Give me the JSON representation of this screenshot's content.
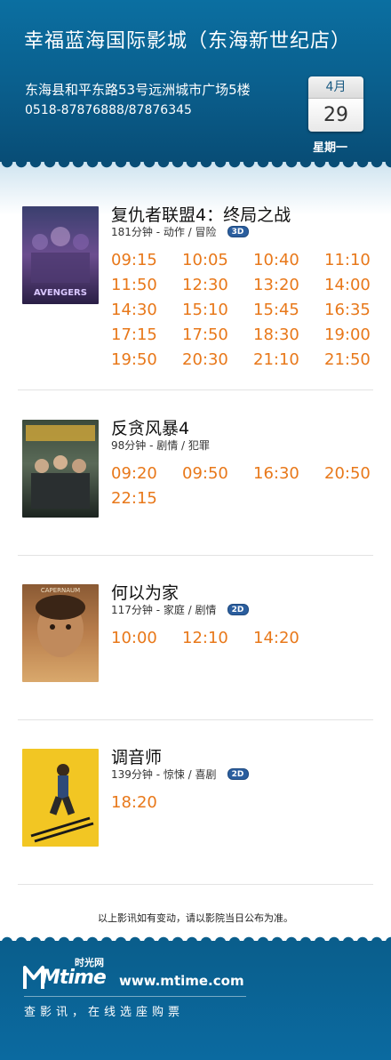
{
  "header": {
    "cinema_name": "幸福蓝海国际影城（东海新世纪店）",
    "address": "东海县和平东路53号远洲城市广场5楼",
    "phone": "0518-87876888/87876345",
    "date": {
      "month": "4月",
      "day": "29",
      "weekday": "星期一"
    }
  },
  "movies": [
    {
      "title": "复仇者联盟4：终局之战",
      "meta": "181分钟 - 动作 / 冒险",
      "badge": "3D",
      "poster_icon": "avengers-poster",
      "times": [
        "09:15",
        "10:05",
        "10:40",
        "11:10",
        "11:50",
        "12:30",
        "13:20",
        "14:00",
        "14:30",
        "15:10",
        "15:45",
        "16:35",
        "17:15",
        "17:50",
        "18:30",
        "19:00",
        "19:50",
        "20:30",
        "21:10",
        "21:50"
      ]
    },
    {
      "title": "反贪风暴4",
      "meta": "98分钟 - 剧情 / 犯罪",
      "badge": "",
      "poster_icon": "ici-poster",
      "times": [
        "09:20",
        "09:50",
        "16:30",
        "20:50",
        "22:15"
      ]
    },
    {
      "title": "何以为家",
      "meta": "117分钟 - 家庭 / 剧情",
      "badge": "2D",
      "poster_icon": "capernaum-poster",
      "poster_text": "CAPERNAUM",
      "times": [
        "10:00",
        "12:10",
        "14:20"
      ]
    },
    {
      "title": "调音师",
      "meta": "139分钟 - 惊悚 / 喜剧",
      "badge": "2D",
      "poster_icon": "andhadhun-poster",
      "times": [
        "18:20"
      ]
    }
  ],
  "notice": "以上影讯如有变动，请以影院当日公布为准。",
  "footer": {
    "logo_text": "Mtime",
    "logo_cn": "时光网",
    "url": "www.mtime.com",
    "slogan": "查影讯，在线选座购票"
  },
  "colors": {
    "header_blue": "#0a5e8c",
    "showtime_orange": "#e8781a",
    "badge_blue": "#2b5e9e"
  }
}
